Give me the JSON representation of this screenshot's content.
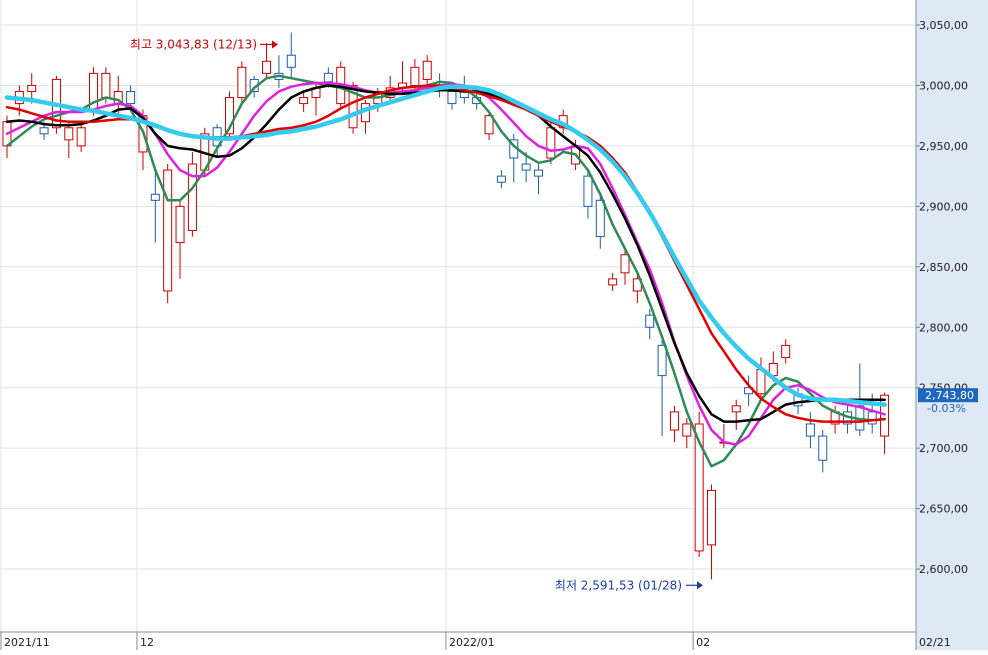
{
  "chart_data": {
    "type": "candlestick",
    "ylim": [
      2550,
      3070
    ],
    "y_ticks": [
      2600,
      2650,
      2700,
      2750,
      2800,
      2850,
      2900,
      2950,
      3000,
      3050
    ],
    "y_tick_labels": [
      "2,600,00",
      "2,650,00",
      "2,700,00",
      "2,750,00",
      "2,800,00",
      "2,850,00",
      "2,900,00",
      "2,950,00",
      "3,000,00",
      "3,050,00"
    ],
    "x_labels": [
      {
        "index": 0,
        "label": "2021/11"
      },
      {
        "index": 11,
        "label": "12"
      },
      {
        "index": 36,
        "label": "2022/01"
      },
      {
        "index": 56,
        "label": "02"
      },
      {
        "index": 72,
        "label": "02/21"
      }
    ],
    "grid": true,
    "candles": [
      [
        2950,
        2970,
        2940,
        2975
      ],
      [
        2985,
        2995,
        2975,
        3000
      ],
      [
        2995,
        3000,
        2985,
        3010
      ],
      [
        2965,
        2960,
        2955,
        2970
      ],
      [
        2965,
        3005,
        2960,
        3008
      ],
      [
        2955,
        2965,
        2940,
        2970
      ],
      [
        2950,
        2965,
        2945,
        2970
      ],
      [
        2980,
        3010,
        2975,
        3015
      ],
      [
        2990,
        3010,
        2985,
        3015
      ],
      [
        2985,
        2995,
        2975,
        3008
      ],
      [
        2995,
        2985,
        2980,
        3000
      ],
      [
        2945,
        2975,
        2930,
        2980
      ],
      [
        2910,
        2905,
        2870,
        2930
      ],
      [
        2830,
        2930,
        2820,
        2935
      ],
      [
        2870,
        2900,
        2840,
        2905
      ],
      [
        2880,
        2935,
        2875,
        2945
      ],
      [
        2930,
        2960,
        2925,
        2965
      ],
      [
        2965,
        2950,
        2940,
        2968
      ],
      [
        2960,
        2990,
        2955,
        2995
      ],
      [
        2990,
        3015,
        2985,
        3020
      ],
      [
        3005,
        2995,
        2990,
        3008
      ],
      [
        3010,
        3020,
        3005,
        3035
      ],
      [
        3010,
        3005,
        2998,
        3025
      ],
      [
        3025,
        3015,
        3005,
        3043.83
      ],
      [
        2985,
        2990,
        2978,
        2995
      ],
      [
        2990,
        2998,
        2975,
        3003
      ],
      [
        3010,
        3003,
        2998,
        3015
      ],
      [
        2985,
        3015,
        2980,
        3020
      ],
      [
        2965,
        3000,
        2960,
        3003
      ],
      [
        2970,
        2985,
        2960,
        2988
      ],
      [
        2985,
        2995,
        2978,
        2998
      ],
      [
        2990,
        2998,
        2985,
        3008
      ],
      [
        2998,
        3002,
        2993,
        3020
      ],
      [
        3000,
        3015,
        2995,
        3022
      ],
      [
        3005,
        3020,
        3000,
        3025
      ],
      [
        3000,
        2998,
        2990,
        3010
      ],
      [
        2995,
        2985,
        2980,
        3000
      ],
      [
        2998,
        2990,
        2985,
        3008
      ],
      [
        2990,
        2985,
        2980,
        2995
      ],
      [
        2960,
        2975,
        2955,
        2978
      ],
      [
        2925,
        2920,
        2915,
        2930
      ],
      [
        2955,
        2940,
        2920,
        2960
      ],
      [
        2935,
        2930,
        2920,
        2945
      ],
      [
        2930,
        2925,
        2910,
        2935
      ],
      [
        2940,
        2965,
        2935,
        2970
      ],
      [
        2965,
        2975,
        2960,
        2980
      ],
      [
        2935,
        2950,
        2930,
        2955
      ],
      [
        2925,
        2900,
        2890,
        2930
      ],
      [
        2905,
        2875,
        2865,
        2910
      ],
      [
        2835,
        2840,
        2830,
        2845
      ],
      [
        2845,
        2860,
        2835,
        2865
      ],
      [
        2830,
        2840,
        2820,
        2845
      ],
      [
        2810,
        2800,
        2790,
        2815
      ],
      [
        2785,
        2760,
        2710,
        2790
      ],
      [
        2715,
        2730,
        2705,
        2735
      ],
      [
        2710,
        2720,
        2700,
        2725
      ],
      [
        2615,
        2720,
        2610,
        2730
      ],
      [
        2620,
        2665,
        2591.53,
        2670
      ],
      [
        2705,
        2705,
        2700,
        2720
      ],
      [
        2730,
        2735,
        2715,
        2740
      ],
      [
        2750,
        2745,
        2735,
        2760
      ],
      [
        2745,
        2765,
        2740,
        2775
      ],
      [
        2760,
        2770,
        2755,
        2780
      ],
      [
        2775,
        2785,
        2770,
        2790
      ],
      [
        2745,
        2735,
        2728,
        2750
      ],
      [
        2720,
        2710,
        2700,
        2730
      ],
      [
        2710,
        2690,
        2680,
        2715
      ],
      [
        2720,
        2730,
        2712,
        2735
      ],
      [
        2730,
        2720,
        2712,
        2735
      ],
      [
        2735,
        2715,
        2710,
        2770
      ],
      [
        2730,
        2720,
        2712,
        2745
      ],
      [
        2710,
        2743.8,
        2695,
        2746
      ]
    ],
    "series": [
      {
        "color": "#2e8b57",
        "values": [
          2950,
          2958,
          2966,
          2972,
          2975,
          2978,
          2980,
          2986,
          2990,
          2988,
          2980,
          2962,
          2930,
          2905,
          2905,
          2915,
          2930,
          2948,
          2965,
          2985,
          2998,
          3006,
          3008,
          3006,
          3004,
          3002,
          3000,
          2998,
          2994,
          2990,
          2990,
          2992,
          2994,
          2996,
          3000,
          3003,
          3002,
          2998,
          2990,
          2978,
          2962,
          2950,
          2942,
          2936,
          2938,
          2945,
          2943,
          2930,
          2910,
          2885,
          2865,
          2845,
          2820,
          2792,
          2762,
          2730,
          2705,
          2685,
          2690,
          2703,
          2720,
          2740,
          2752,
          2758,
          2755,
          2745,
          2735,
          2730,
          2726,
          2724,
          2723,
          2724
        ]
      },
      {
        "color": "#e020e0",
        "values": [
          2960,
          2965,
          2970,
          2975,
          2978,
          2978,
          2978,
          2980,
          2983,
          2985,
          2983,
          2975,
          2960,
          2943,
          2930,
          2925,
          2925,
          2932,
          2945,
          2960,
          2975,
          2987,
          2995,
          2999,
          3001,
          3002,
          3002,
          3001,
          2999,
          2996,
          2994,
          2994,
          2995,
          2996,
          2998,
          3000,
          3001,
          3000,
          2996,
          2990,
          2980,
          2969,
          2958,
          2950,
          2946,
          2947,
          2950,
          2948,
          2935,
          2915,
          2893,
          2870,
          2848,
          2820,
          2788,
          2760,
          2735,
          2715,
          2705,
          2703,
          2710,
          2725,
          2740,
          2750,
          2752,
          2748,
          2742,
          2738,
          2736,
          2734,
          2731,
          2728
        ]
      },
      {
        "color": "#000000",
        "values": [
          2970,
          2971,
          2970,
          2968,
          2967,
          2967,
          2968,
          2971,
          2975,
          2980,
          2981,
          2973,
          2960,
          2950,
          2948,
          2947,
          2944,
          2941,
          2942,
          2948,
          2957,
          2968,
          2980,
          2990,
          2995,
          2998,
          3000,
          2999,
          2997,
          2995,
          2994,
          2993,
          2993,
          2994,
          2995,
          2996,
          2996,
          2995,
          2995,
          2993,
          2990,
          2986,
          2982,
          2975,
          2966,
          2958,
          2950,
          2942,
          2928,
          2910,
          2890,
          2868,
          2843,
          2815,
          2787,
          2762,
          2743,
          2728,
          2722,
          2722,
          2723,
          2724,
          2730,
          2736,
          2738,
          2739,
          2740,
          2740,
          2740,
          2740,
          2740,
          2740
        ]
      },
      {
        "color": "#e00000",
        "values": [
          2982,
          2980,
          2977,
          2974,
          2971,
          2970,
          2970,
          2970,
          2971,
          2972,
          2972,
          2970,
          2966,
          2963,
          2960,
          2958,
          2957,
          2957,
          2957,
          2958,
          2960,
          2962,
          2964,
          2965,
          2967,
          2970,
          2975,
          2981,
          2986,
          2990,
          2993,
          2996,
          2998,
          2999,
          3000,
          3000,
          2998,
          2996,
          2994,
          2991,
          2988,
          2984,
          2980,
          2975,
          2970,
          2966,
          2962,
          2957,
          2950,
          2940,
          2928,
          2912,
          2895,
          2875,
          2855,
          2835,
          2815,
          2795,
          2780,
          2765,
          2752,
          2741,
          2734,
          2728,
          2725,
          2723,
          2722,
          2722,
          2722,
          2722,
          2723,
          2724
        ]
      },
      {
        "color": "#33ccee",
        "values": [
          2990,
          2989,
          2988,
          2986,
          2984,
          2982,
          2980,
          2979,
          2977,
          2975,
          2973,
          2970,
          2967,
          2963,
          2960,
          2958,
          2957,
          2956,
          2956,
          2957,
          2958,
          2959,
          2961,
          2962,
          2964,
          2966,
          2969,
          2972,
          2976,
          2980,
          2983,
          2986,
          2989,
          2992,
          2995,
          2998,
          2999,
          2999,
          2998,
          2996,
          2992,
          2987,
          2982,
          2977,
          2972,
          2968,
          2962,
          2955,
          2947,
          2937,
          2925,
          2911,
          2895,
          2877,
          2858,
          2840,
          2822,
          2808,
          2795,
          2784,
          2774,
          2766,
          2758,
          2750,
          2744,
          2741,
          2740,
          2740,
          2739,
          2738,
          2737,
          2736
        ]
      }
    ],
    "annotations": [
      {
        "text": "최고 3,043,83 (12/13)",
        "index": 23,
        "value": 3043.83
      },
      {
        "text": "최저 2,591,53 (01/28)",
        "index": 57,
        "value": 2591.53
      }
    ],
    "last_price": "2,743,80",
    "last_change": "-0.03%",
    "last_value": 2743.8
  },
  "colors": {
    "up": "#cc0000",
    "down": "#1a5ea8",
    "axis_bg": "#dfe8f5",
    "grid": "#dde2ea",
    "price_box": "#1f66c0",
    "change_text": "#1f66c0",
    "high_text": "#cc0000",
    "low_text": "#1a3ea8"
  }
}
